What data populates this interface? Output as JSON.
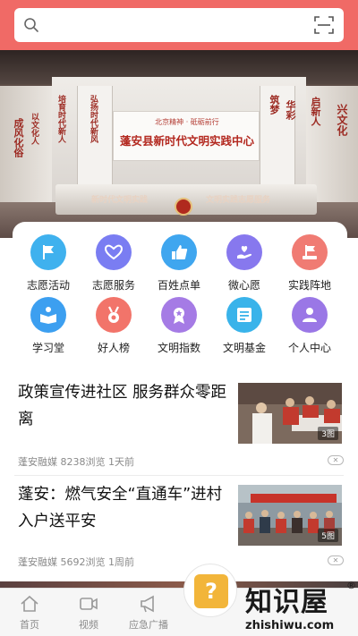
{
  "search": {
    "placeholder": ""
  },
  "banner": {
    "small_text": "北京精神 · 砥砺前行",
    "title": "蓬安县新时代文明实践中心",
    "left_texts": [
      "成风化俗",
      "以文化人",
      "培育时代新人",
      "弘扬时代新风"
    ],
    "right_texts": [
      "筑梦",
      "华彩",
      "启新人",
      "兴文化"
    ],
    "desk_left": "新时代文明实践",
    "desk_right": "文明实践志愿服务"
  },
  "menu": [
    {
      "label": "志愿活动",
      "icon": "flag-icon",
      "color": "#3fb1ee"
    },
    {
      "label": "志愿服务",
      "icon": "heart-hands-icon",
      "color": "#7a7df2"
    },
    {
      "label": "百姓点单",
      "icon": "thumbs-up-icon",
      "color": "#3fa6ef"
    },
    {
      "label": "微心愿",
      "icon": "heart-hand-icon",
      "color": "#8778ee"
    },
    {
      "label": "实践阵地",
      "icon": "flag-stand-icon",
      "color": "#f07b73"
    },
    {
      "label": "学习堂",
      "icon": "reading-icon",
      "color": "#3c9ff0"
    },
    {
      "label": "好人榜",
      "icon": "medal-icon",
      "color": "#f2746a"
    },
    {
      "label": "文明指数",
      "icon": "ribbon-icon",
      "color": "#a57be5"
    },
    {
      "label": "文明基金",
      "icon": "certificate-icon",
      "color": "#39b3ea"
    },
    {
      "label": "个人中心",
      "icon": "person-icon",
      "color": "#9a77e6"
    }
  ],
  "news": [
    {
      "title": "政策宣传进社区 服务群众零距离",
      "source": "蓬安融媒",
      "views": "8238浏览",
      "time": "1天前",
      "img_count": "3图",
      "close": "✕"
    },
    {
      "title": "蓬安：燃气安全“直通车”进村入户送平安",
      "source": "蓬安融媒",
      "views": "5692浏览",
      "time": "1周前",
      "img_count": "5图",
      "close": "✕"
    }
  ],
  "tabs": [
    {
      "label": "首页",
      "icon": "home-icon"
    },
    {
      "label": "视频",
      "icon": "video-icon"
    },
    {
      "label": "应急广播",
      "icon": "megaphone-icon"
    }
  ],
  "fab": {
    "symbol": "?"
  },
  "watermark": {
    "main": "知识屋",
    "sub": "zhishiwu.com",
    "reg": "®"
  }
}
